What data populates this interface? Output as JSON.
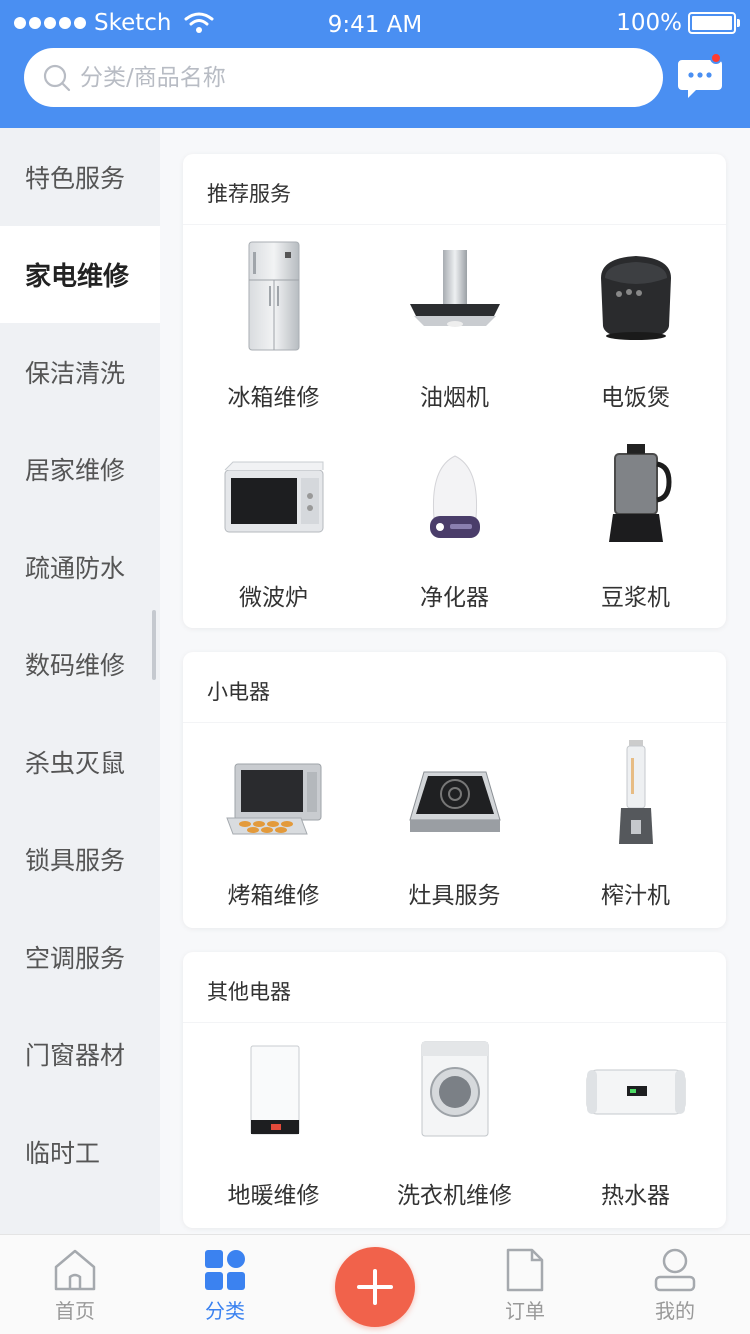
{
  "status_bar": {
    "carrier": "Sketch",
    "time": "9:41 AM",
    "battery": "100%"
  },
  "search": {
    "placeholder": "分类/商品名称",
    "value": ""
  },
  "sidebar": {
    "items": [
      {
        "label": "特色服务",
        "active": false
      },
      {
        "label": "家电维修",
        "active": true
      },
      {
        "label": "保洁清洗",
        "active": false
      },
      {
        "label": "居家维修",
        "active": false
      },
      {
        "label": "疏通防水",
        "active": false
      },
      {
        "label": "数码维修",
        "active": false
      },
      {
        "label": "杀虫灭鼠",
        "active": false
      },
      {
        "label": "锁具服务",
        "active": false
      },
      {
        "label": "空调服务",
        "active": false
      },
      {
        "label": "门窗器材",
        "active": false
      },
      {
        "label": "临时工",
        "active": false
      }
    ]
  },
  "sections": [
    {
      "title": "推荐服务",
      "items": [
        {
          "label": "冰箱维修",
          "icon": "fridge-icon"
        },
        {
          "label": "油烟机",
          "icon": "range-hood-icon"
        },
        {
          "label": "电饭煲",
          "icon": "rice-cooker-icon"
        },
        {
          "label": "微波炉",
          "icon": "microwave-icon"
        },
        {
          "label": "净化器",
          "icon": "purifier-icon"
        },
        {
          "label": "豆浆机",
          "icon": "soymilk-maker-icon"
        }
      ]
    },
    {
      "title": "小电器",
      "items": [
        {
          "label": "烤箱维修",
          "icon": "oven-icon"
        },
        {
          "label": "灶具服务",
          "icon": "stove-icon"
        },
        {
          "label": "榨汁机",
          "icon": "juicer-icon"
        }
      ]
    },
    {
      "title": "其他电器",
      "items": [
        {
          "label": "地暖维修",
          "icon": "floor-heater-icon"
        },
        {
          "label": "洗衣机维修",
          "icon": "washing-machine-icon"
        },
        {
          "label": "热水器",
          "icon": "water-heater-icon"
        }
      ]
    }
  ],
  "tabbar": {
    "items": [
      {
        "label": "首页",
        "icon": "home-icon",
        "active": false
      },
      {
        "label": "分类",
        "icon": "category-icon",
        "active": true
      },
      {
        "label": "",
        "icon": "plus-icon",
        "active": false
      },
      {
        "label": "订单",
        "icon": "order-icon",
        "active": false
      },
      {
        "label": "我的",
        "icon": "profile-icon",
        "active": false
      }
    ]
  },
  "colors": {
    "header": "#4a8ff2",
    "accent": "#3b82f0",
    "fab": "#f1624b",
    "notification": "#ff3b30"
  }
}
